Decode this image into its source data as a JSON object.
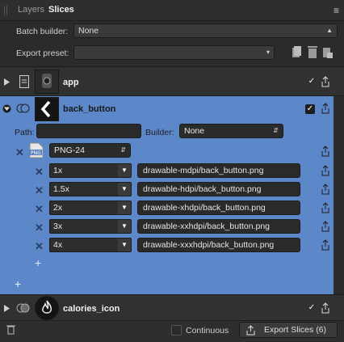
{
  "tabs": [
    {
      "label": "Layers"
    },
    {
      "label": "Slices"
    }
  ],
  "batch_builder": {
    "label": "Batch builder:",
    "value": "None"
  },
  "export_preset": {
    "label": "Export preset:",
    "value": ""
  },
  "slices": [
    {
      "name": "app"
    },
    {
      "name": "back_button"
    },
    {
      "name": "calories_icon"
    }
  ],
  "expanded": {
    "path_label": "Path:",
    "path_value": "",
    "builder_label": "Builder:",
    "builder_value": "None",
    "format_badge": "PNG",
    "format_value": "PNG-24",
    "rows": [
      {
        "scale": "1x",
        "path": "drawable-mdpi/back_button.png"
      },
      {
        "scale": "1.5x",
        "path": "drawable-hdpi/back_button.png"
      },
      {
        "scale": "2x",
        "path": "drawable-xhdpi/back_button.png"
      },
      {
        "scale": "3x",
        "path": "drawable-xxhdpi/back_button.png"
      },
      {
        "scale": "4x",
        "path": "drawable-xxxhdpi/back_button.png"
      }
    ]
  },
  "bottom": {
    "continuous_label": "Continuous",
    "export_label": "Export Slices (6)"
  },
  "icons": {
    "menu": "hamburger-icon",
    "delete": "trash-icon",
    "share": "export-icon"
  },
  "colors": {
    "accent": "#5c87c9",
    "panel": "#2b2b2b"
  }
}
